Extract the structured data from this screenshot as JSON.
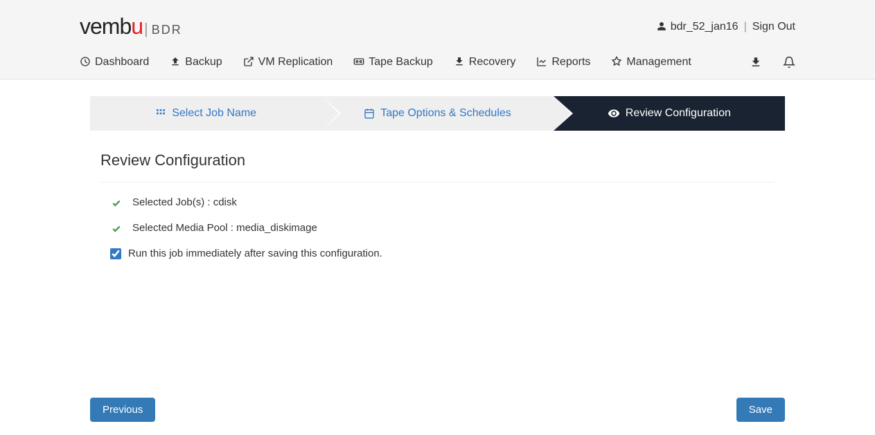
{
  "header": {
    "logo_text": "vembu",
    "logo_suffix": "BDR",
    "username": "bdr_52_jan16",
    "signout_label": "Sign Out"
  },
  "nav": {
    "items": [
      {
        "label": "Dashboard"
      },
      {
        "label": "Backup"
      },
      {
        "label": "VM Replication"
      },
      {
        "label": "Tape Backup"
      },
      {
        "label": "Recovery"
      },
      {
        "label": "Reports"
      },
      {
        "label": "Management"
      }
    ]
  },
  "wizard": {
    "steps": [
      {
        "label": "Select Job Name",
        "active": false
      },
      {
        "label": "Tape Options & Schedules",
        "active": false
      },
      {
        "label": "Review Configuration",
        "active": true
      }
    ]
  },
  "page": {
    "title": "Review Configuration",
    "review_items": [
      "Selected Job(s) : cdisk",
      "Selected Media Pool : media_diskimage"
    ],
    "checkbox_label": "Run this job immediately after saving this configuration.",
    "checkbox_checked": true
  },
  "buttons": {
    "previous": "Previous",
    "save": "Save"
  }
}
